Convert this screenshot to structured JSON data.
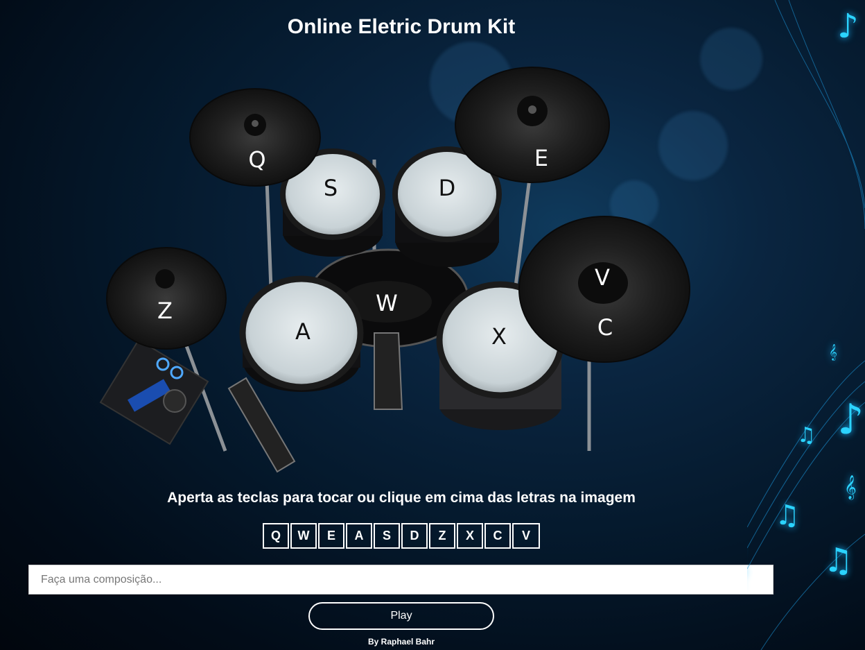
{
  "page": {
    "title": "Online Eletric Drum Kit",
    "instruction": "Aperta as teclas para tocar ou clique em cima das letras na imagem",
    "credit": "By Raphael Bahr"
  },
  "drum_pads": [
    {
      "key": "Q",
      "name": "crash-cymbal-left"
    },
    {
      "key": "E",
      "name": "ride-cymbal"
    },
    {
      "key": "S",
      "name": "tom-1"
    },
    {
      "key": "D",
      "name": "tom-2"
    },
    {
      "key": "W",
      "name": "kick-drum"
    },
    {
      "key": "Z",
      "name": "hi-hat"
    },
    {
      "key": "A",
      "name": "snare"
    },
    {
      "key": "X",
      "name": "floor-tom"
    },
    {
      "key": "V",
      "name": "crash-cymbal-bell"
    },
    {
      "key": "C",
      "name": "crash-cymbal-edge"
    }
  ],
  "keys": [
    "Q",
    "W",
    "E",
    "A",
    "S",
    "D",
    "Z",
    "X",
    "C",
    "V"
  ],
  "composer": {
    "placeholder": "Faça uma composição...",
    "value": ""
  },
  "play_button": {
    "label": "Play"
  },
  "colors": {
    "accent_note": "#2bd3ff",
    "background_dark": "#020c18",
    "background_glow": "#0f3a5c"
  }
}
